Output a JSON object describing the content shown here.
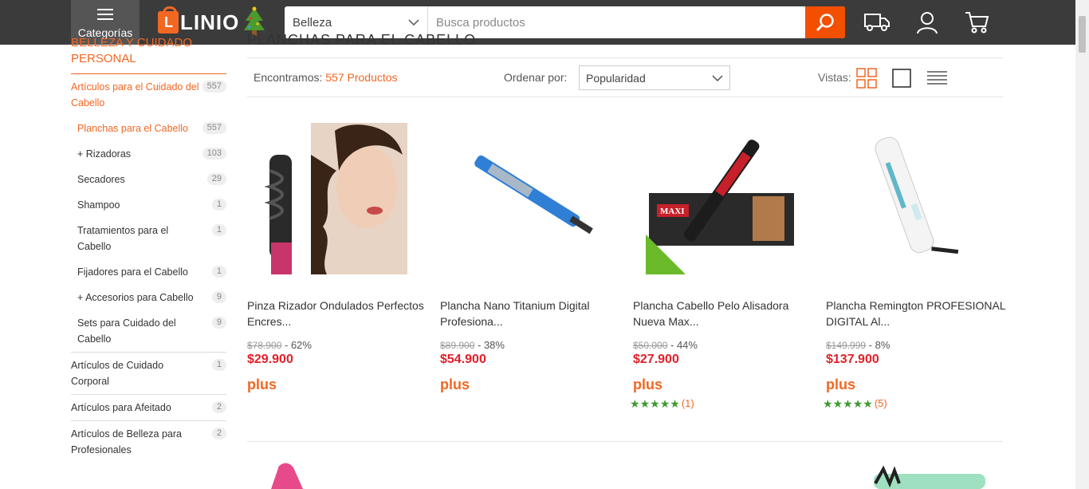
{
  "header": {
    "categories_label": "Categorías",
    "logo_text": "LINIO",
    "search_category": "Belleza",
    "search_placeholder": "Busca productos",
    "icons": [
      "truck-icon",
      "user-icon",
      "cart-icon"
    ]
  },
  "colors": {
    "brand": "#f26722",
    "header_bg": "#3b3b3b",
    "price": "#e0202a",
    "rating": "#3d9b2e"
  },
  "sidebar": {
    "heading": "BELLEZA Y CUIDADO PERSONAL",
    "heading_count": "557",
    "items": [
      {
        "label": "Artículos para el Cuidado del Cabello",
        "count": "557",
        "active": true,
        "level": 0
      },
      {
        "label": "Planchas para el Cabello",
        "count": "557",
        "active": true,
        "level": 1
      },
      {
        "label": "+ Rizadoras",
        "count": "103",
        "active": false,
        "level": 1
      },
      {
        "label": "Secadores",
        "count": "29",
        "active": false,
        "level": 1
      },
      {
        "label": "Shampoo",
        "count": "1",
        "active": false,
        "level": 1
      },
      {
        "label": "Tratamientos para el Cabello",
        "count": "1",
        "active": false,
        "level": 1
      },
      {
        "label": "Fijadores para el Cabello",
        "count": "1",
        "active": false,
        "level": 1
      },
      {
        "label": "+ Accesorios para Cabello",
        "count": "9",
        "active": false,
        "level": 1
      },
      {
        "label": "Sets para Cuidado del Cabello",
        "count": "9",
        "active": false,
        "level": 1
      },
      {
        "label": "Artículos de Cuidado Corporal",
        "count": "1",
        "active": false,
        "level": 0
      },
      {
        "label": "Artículos para Afeitado",
        "count": "2",
        "active": false,
        "level": 0
      },
      {
        "label": "Artículos de Belleza para Profesionales",
        "count": "2",
        "active": false,
        "level": 0
      }
    ]
  },
  "main": {
    "section_title": "PLANCHAS PARA EL CABELLO",
    "found_label": "Encontramos:",
    "found_count": "557 Productos",
    "order_label": "Ordenar por:",
    "order_value": "Popularidad",
    "views_label": "Vistas:"
  },
  "products": [
    {
      "name": "Pinza Rizador Ondulados Perfectos Encres...",
      "old_price": "$78.900",
      "discount": " - 62%",
      "price": "$29.900",
      "plus": "plus",
      "rating_count": null
    },
    {
      "name": "Plancha Nano Titanium Digital Profesiona...",
      "old_price": "$89.900",
      "discount": " - 38%",
      "price": "$54.900",
      "plus": "plus",
      "rating_count": null
    },
    {
      "name": "Plancha Cabello Pelo Alisadora Nueva Max...",
      "old_price": "$50.000",
      "discount": " - 44%",
      "price": "$27.900",
      "plus": "plus",
      "rating_count": "(1)"
    },
    {
      "name": "Plancha Remington PROFESIONAL DIGITAL Al...",
      "old_price": "$149.999",
      "discount": " - 8%",
      "price": "$137.900",
      "plus": "plus",
      "rating_count": "(5)"
    }
  ]
}
